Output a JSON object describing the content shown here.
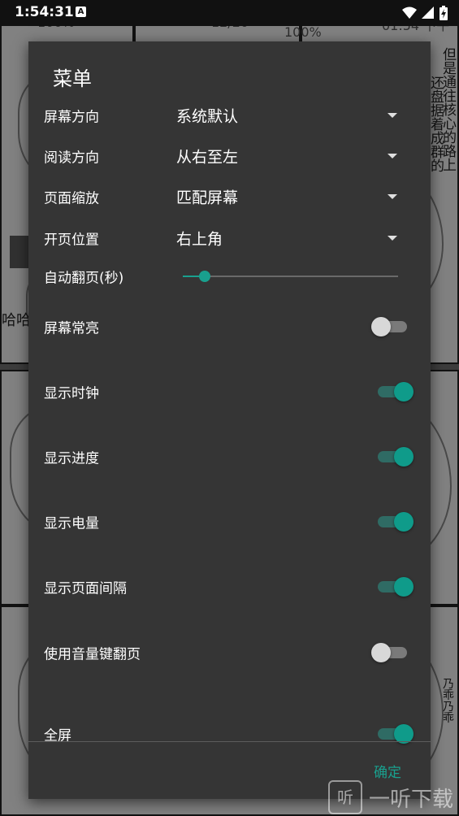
{
  "status_bar": {
    "time": "1:54:31",
    "notification_icon": "A"
  },
  "background": {
    "page_top_left": "100%",
    "page_indicator": "12/20",
    "page_mid": "100%",
    "clock_text": "01:54 下午",
    "vertical_text": [
      "但是",
      "通往",
      "核心",
      "的路",
      "上"
    ],
    "vertical_text_2": [
      "还盘",
      "据着",
      "成群",
      "的"
    ],
    "sfx_text": "哈哈",
    "small_text": "乃乖乃乖"
  },
  "dialog": {
    "title": "菜单",
    "dropdowns": [
      {
        "label": "屏幕方向",
        "value": "系统默认"
      },
      {
        "label": "阅读方向",
        "value": "从右至左"
      },
      {
        "label": "页面缩放",
        "value": "匹配屏幕"
      },
      {
        "label": "开页位置",
        "value": "右上角"
      }
    ],
    "slider": {
      "label": "自动翻页(秒)",
      "level": 0.1
    },
    "toggles": [
      {
        "label": "屏幕常亮",
        "on": false
      },
      {
        "label": "显示时钟",
        "on": true
      },
      {
        "label": "显示进度",
        "on": true
      },
      {
        "label": "显示电量",
        "on": true
      },
      {
        "label": "显示页面间隔",
        "on": true
      },
      {
        "label": "使用音量键翻页",
        "on": false
      },
      {
        "label": "全屏",
        "on": true
      }
    ],
    "confirm_label": "确定"
  },
  "watermark": {
    "icon_char": "听",
    "text": "一听下载"
  },
  "colors": {
    "accent": "#19a08e",
    "dialog_bg": "#353535"
  }
}
